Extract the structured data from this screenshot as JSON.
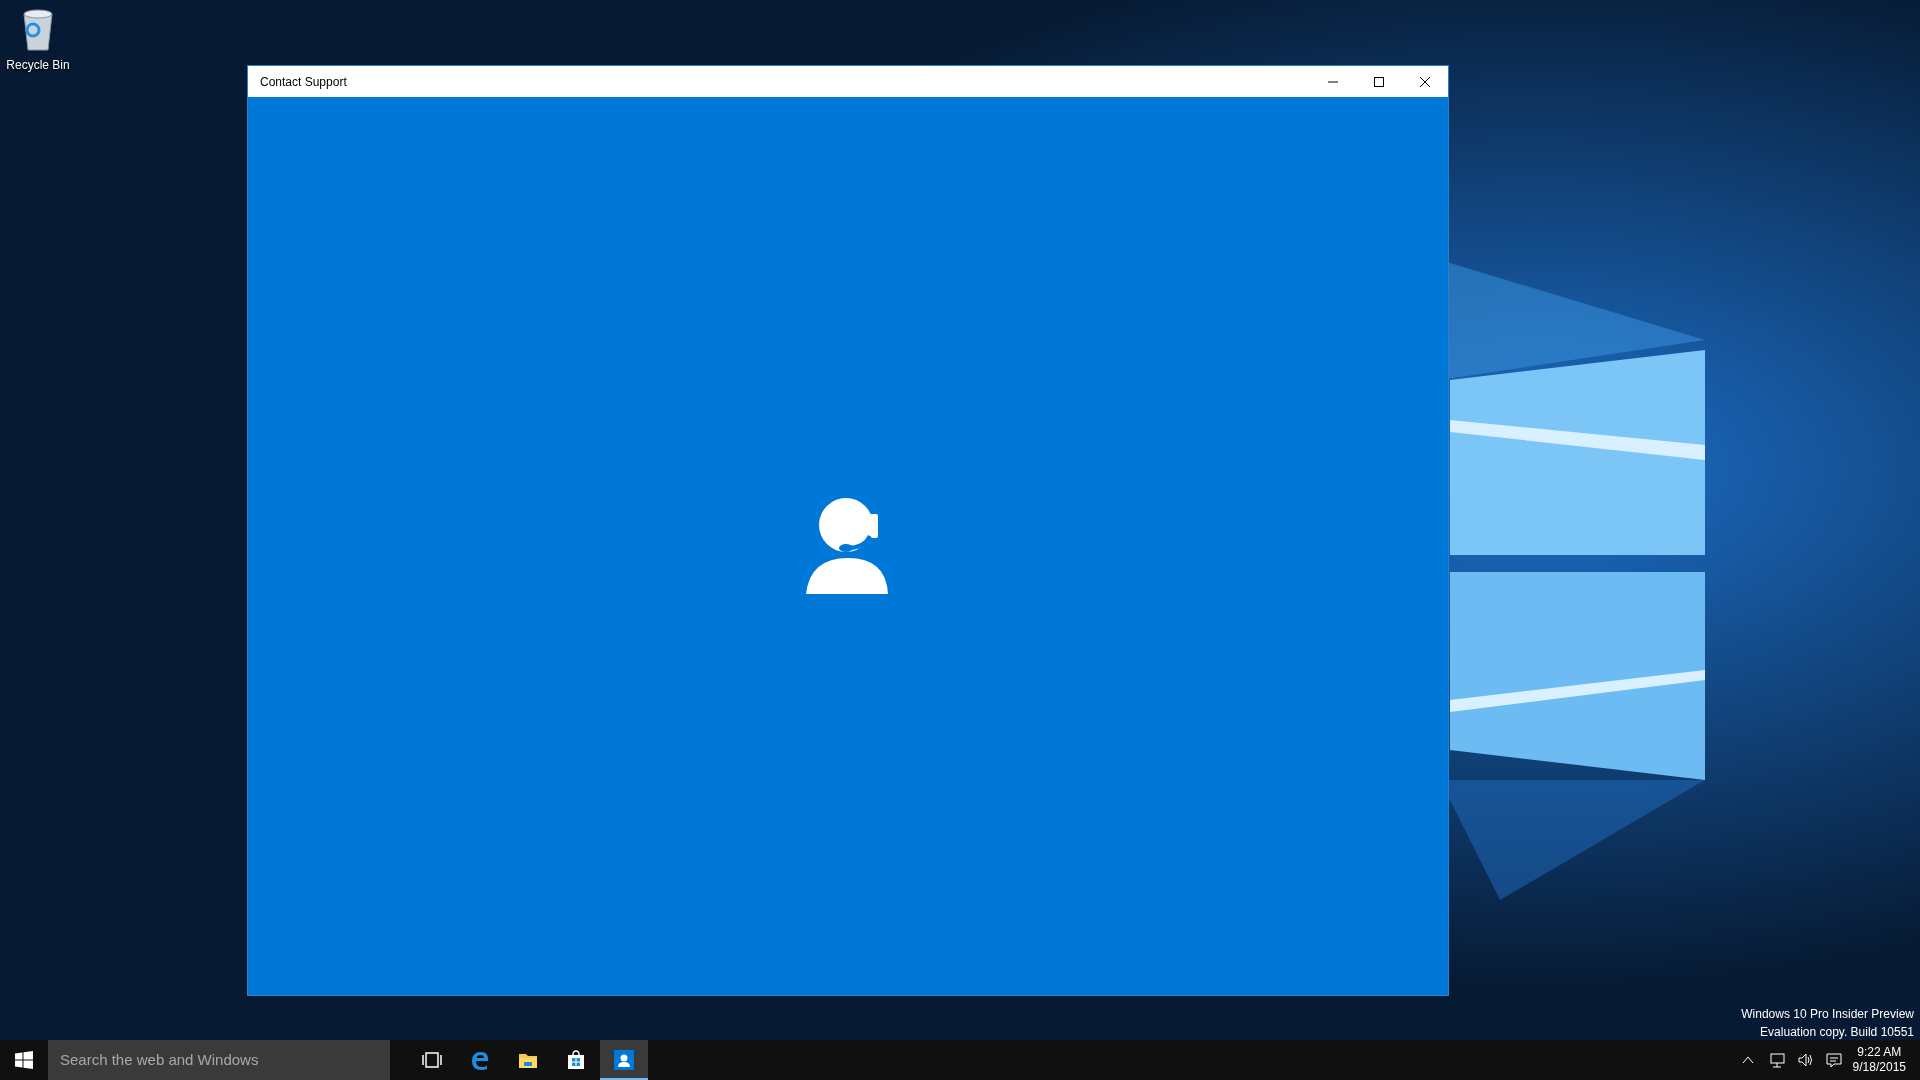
{
  "desktop": {
    "icons": [
      {
        "kind": "recycle-bin",
        "label": "Recycle Bin"
      }
    ],
    "watermark": [
      "Windows 10 Pro Insider Preview",
      "Evaluation copy. Build 10551"
    ]
  },
  "window": {
    "title": "Contact Support"
  },
  "taskbar": {
    "search": {
      "placeholder": "Search the web and Windows"
    },
    "apps": [
      {
        "kind": "taskview",
        "selected": false
      },
      {
        "kind": "edge",
        "selected": false
      },
      {
        "kind": "explorer",
        "selected": false
      },
      {
        "kind": "store",
        "selected": false
      },
      {
        "kind": "support",
        "selected": true
      }
    ],
    "clock": {
      "time": "9:22 AM",
      "date": "9/18/2015"
    }
  }
}
